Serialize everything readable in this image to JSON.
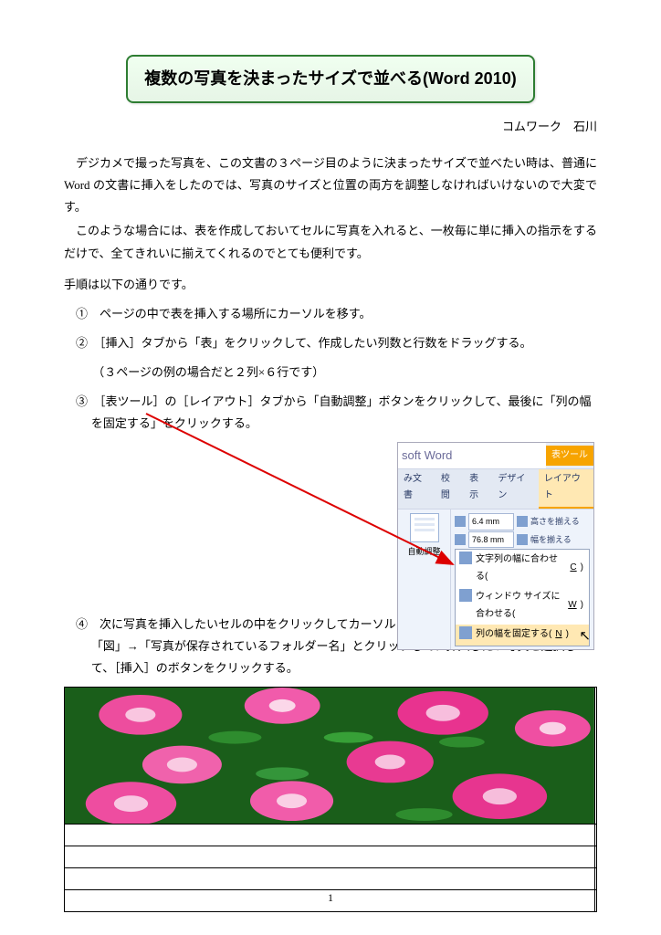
{
  "title": "複数の写真を決まったサイズで並べる(Word 2010)",
  "author": "コムワーク　石川",
  "intro": {
    "p1": "デジカメで撮った写真を、この文書の３ページ目のように決まったサイズで並べたい時は、普通に Word の文書に挿入をしたのでは、写真のサイズと位置の両方を調整しなければいけないので大変です。",
    "p2": "このような場合には、表を作成しておいてセルに写真を入れると、一枚毎に単に挿入の指示をするだけで、全てきれいに揃えてくれるのでとても便利です。"
  },
  "procedure_label": "手順は以下の通りです。",
  "steps": {
    "s1": "①　ページの中で表を挿入する場所にカーソルを移す。",
    "s2": "②　［挿入］タブから「表」をクリックして、作成したい列数と行数をドラッグする。",
    "s2_sub": "（３ページの例の場合だと２列×６行です）",
    "s3": "③　［表ツール］の［レイアウト］タブから「自動調整」ボタンをクリックして、最後に「列の幅を固定する」をクリックする。",
    "s4": "④　次に写真を挿入したいセルの中をクリックしてカーソルを移しておいてから、［挿入］タブ→「図」→「写真が保存されているフォルダー名」とクリックして、挿入したい写真を選択して、［挿入］のボタンをクリックする。"
  },
  "ribbon": {
    "word_title": "soft Word",
    "tool_title": "表ツール",
    "tabs": {
      "t1": "み文書",
      "t2": "校閲",
      "t3": "表示",
      "t4": "デザイン",
      "t5": "レイアウト"
    },
    "auto_adjust": "自動調整",
    "height_lbl": "高さを揃える",
    "width_lbl": "幅を揃える",
    "h_val": "6.4 mm",
    "w_val": "76.8 mm",
    "menu": {
      "m1_pre": "文字列の幅に合わせる(",
      "m1_u": "C",
      "m1_post": ")",
      "m2_pre": "ウィンドウ サイズに合わせる(",
      "m2_u": "W",
      "m2_post": ")",
      "m3_pre": "列の幅を固定する(",
      "m3_u": "N",
      "m3_post": ")"
    }
  },
  "page_number": "1"
}
